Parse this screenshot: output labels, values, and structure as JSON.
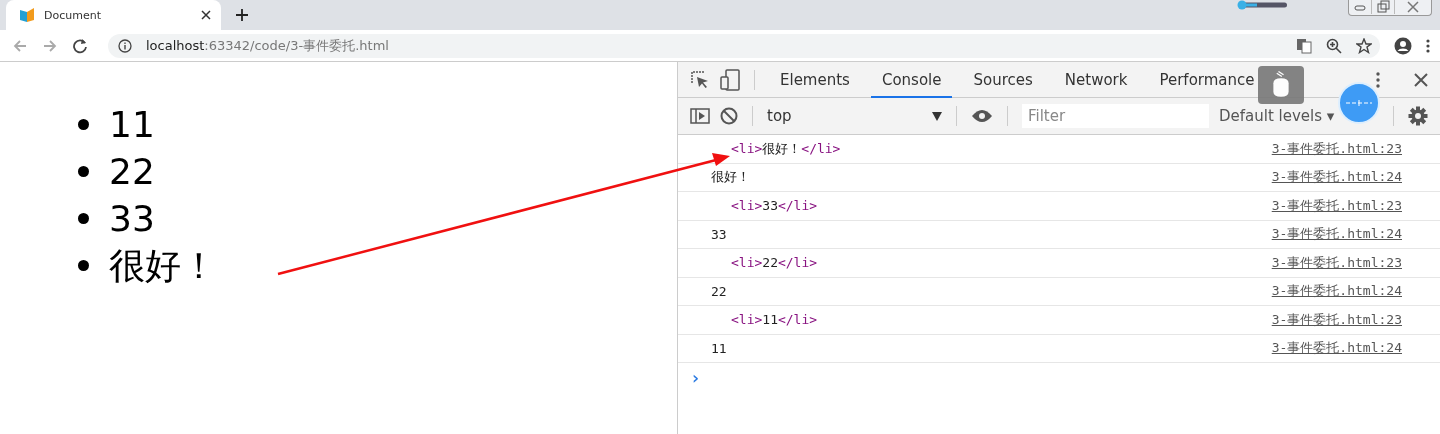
{
  "browser_tab": {
    "title": "Document"
  },
  "address_bar": {
    "host": "localhost",
    "path": ":63342/code/3-事件委托.html"
  },
  "page_list": [
    "11",
    "22",
    "33",
    "很好！"
  ],
  "devtools": {
    "tabs": [
      {
        "label": "Elements",
        "selected": false
      },
      {
        "label": "Console",
        "selected": true
      },
      {
        "label": "Sources",
        "selected": false
      },
      {
        "label": "Network",
        "selected": false
      },
      {
        "label": "Performance",
        "selected": false
      }
    ],
    "context": "top",
    "filter": {
      "placeholder": "Filter"
    },
    "levels": "Default levels ▾",
    "console_rows": [
      {
        "kind": "element",
        "open_tag": "<li>",
        "content": "很好！",
        "close_tag": "</li>",
        "source": "3-事件委托.html:23"
      },
      {
        "kind": "text",
        "content": "很好！",
        "source": "3-事件委托.html:24"
      },
      {
        "kind": "element",
        "open_tag": "<li>",
        "content": "33",
        "close_tag": "</li>",
        "source": "3-事件委托.html:23"
      },
      {
        "kind": "text",
        "content": "33",
        "source": "3-事件委托.html:24"
      },
      {
        "kind": "element",
        "open_tag": "<li>",
        "content": "22",
        "close_tag": "</li>",
        "source": "3-事件委托.html:23"
      },
      {
        "kind": "text",
        "content": "22",
        "source": "3-事件委托.html:24"
      },
      {
        "kind": "element",
        "open_tag": "<li>",
        "content": "11",
        "close_tag": "</li>",
        "source": "3-事件委托.html:23"
      },
      {
        "kind": "text",
        "content": "11",
        "source": "3-事件委托.html:24"
      }
    ],
    "prompt": "›"
  }
}
